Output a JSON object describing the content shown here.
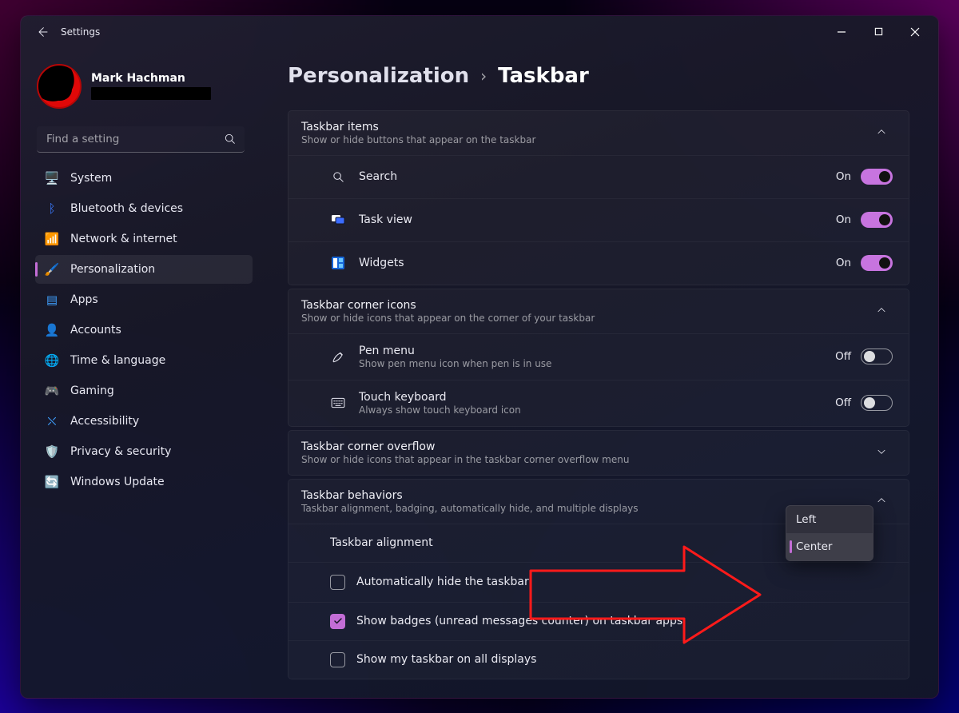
{
  "window": {
    "title": "Settings"
  },
  "user": {
    "name": "Mark Hachman"
  },
  "search": {
    "placeholder": "Find a setting"
  },
  "nav": {
    "items": [
      {
        "id": "system",
        "label": "System"
      },
      {
        "id": "bluetooth",
        "label": "Bluetooth & devices"
      },
      {
        "id": "network",
        "label": "Network & internet"
      },
      {
        "id": "personalization",
        "label": "Personalization"
      },
      {
        "id": "apps",
        "label": "Apps"
      },
      {
        "id": "accounts",
        "label": "Accounts"
      },
      {
        "id": "time",
        "label": "Time & language"
      },
      {
        "id": "gaming",
        "label": "Gaming"
      },
      {
        "id": "accessibility",
        "label": "Accessibility"
      },
      {
        "id": "privacy",
        "label": "Privacy & security"
      },
      {
        "id": "update",
        "label": "Windows Update"
      }
    ],
    "active": "personalization"
  },
  "breadcrumb": {
    "parent": "Personalization",
    "current": "Taskbar"
  },
  "sections": {
    "taskbarItems": {
      "title": "Taskbar items",
      "subtitle": "Show or hide buttons that appear on the taskbar",
      "expanded": true,
      "rows": [
        {
          "id": "search",
          "label": "Search",
          "state": "On",
          "on": true
        },
        {
          "id": "taskview",
          "label": "Task view",
          "state": "On",
          "on": true
        },
        {
          "id": "widgets",
          "label": "Widgets",
          "state": "On",
          "on": true
        }
      ]
    },
    "cornerIcons": {
      "title": "Taskbar corner icons",
      "subtitle": "Show or hide icons that appear on the corner of your taskbar",
      "expanded": true,
      "rows": [
        {
          "id": "pen",
          "label": "Pen menu",
          "sub": "Show pen menu icon when pen is in use",
          "state": "Off",
          "on": false
        },
        {
          "id": "touch",
          "label": "Touch keyboard",
          "sub": "Always show touch keyboard icon",
          "state": "Off",
          "on": false
        }
      ]
    },
    "overflow": {
      "title": "Taskbar corner overflow",
      "subtitle": "Show or hide icons that appear in the taskbar corner overflow menu",
      "expanded": false
    },
    "behaviors": {
      "title": "Taskbar behaviors",
      "subtitle": "Taskbar alignment, badging, automatically hide, and multiple displays",
      "expanded": true,
      "alignment": {
        "label": "Taskbar alignment",
        "options": [
          "Left",
          "Center"
        ],
        "selected": "Center"
      },
      "checks": [
        {
          "id": "autohide",
          "label": "Automatically hide the taskbar",
          "checked": false
        },
        {
          "id": "badges",
          "label": "Show badges (unread messages counter) on taskbar apps",
          "checked": true
        },
        {
          "id": "alldisp",
          "label": "Show my taskbar on all displays",
          "checked": false
        }
      ]
    }
  }
}
